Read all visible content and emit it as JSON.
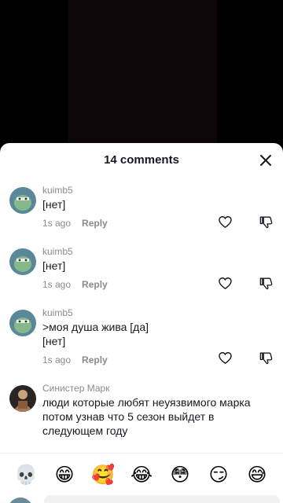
{
  "sheet": {
    "title": "14 comments"
  },
  "comments": [
    {
      "username": "kuimb5",
      "lines": [
        "[нет]"
      ],
      "time": "1s ago",
      "reply_label": "Reply"
    },
    {
      "username": "kuimb5",
      "lines": [
        "[нет]"
      ],
      "time": "1s ago",
      "reply_label": "Reply"
    },
    {
      "username": "kuimb5",
      "lines": [
        ">моя душа жива [да]",
        "[нет]"
      ],
      "time": "1s ago",
      "reply_label": "Reply"
    },
    {
      "username": "Синистер Марк",
      "lines": [
        "люди которые любят неуязвимого марка",
        "потом узнав что 5 сезон выйдет в",
        "следующем году"
      ]
    }
  ],
  "emoji_bar": [
    "💀",
    "😁",
    "🥰",
    "😂",
    "😳",
    "😏",
    "😅"
  ],
  "colors": {
    "text": "#161823",
    "muted": "#8a8b91",
    "avatar_bg": "#5b8899",
    "avatar_face": "#86b98a"
  },
  "icons": [
    "close-icon",
    "heart-icon",
    "dislike-icon"
  ]
}
